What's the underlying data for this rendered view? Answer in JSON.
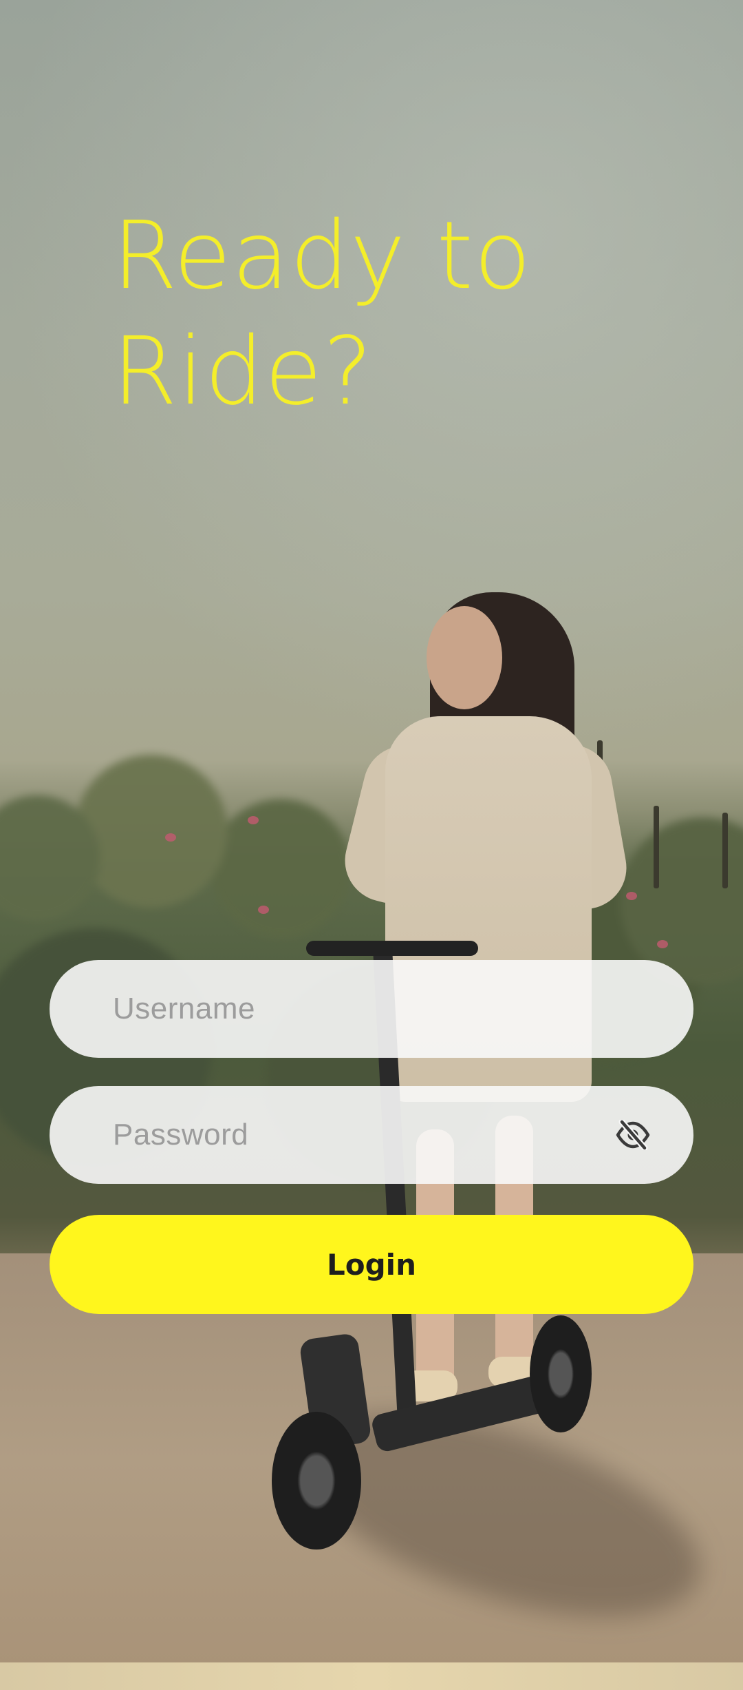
{
  "headline": {
    "line1": "Ready to",
    "line2": "Ride?"
  },
  "form": {
    "username": {
      "value": "",
      "placeholder": "Username"
    },
    "password": {
      "value": "",
      "placeholder": "Password",
      "toggle_icon": "eye-off-icon"
    },
    "login_label": "Login"
  },
  "colors": {
    "accent": "#fff61d",
    "headline": "#f4ee2a",
    "field_bg": "#f8f8f8",
    "placeholder": "#9c9c9c"
  }
}
